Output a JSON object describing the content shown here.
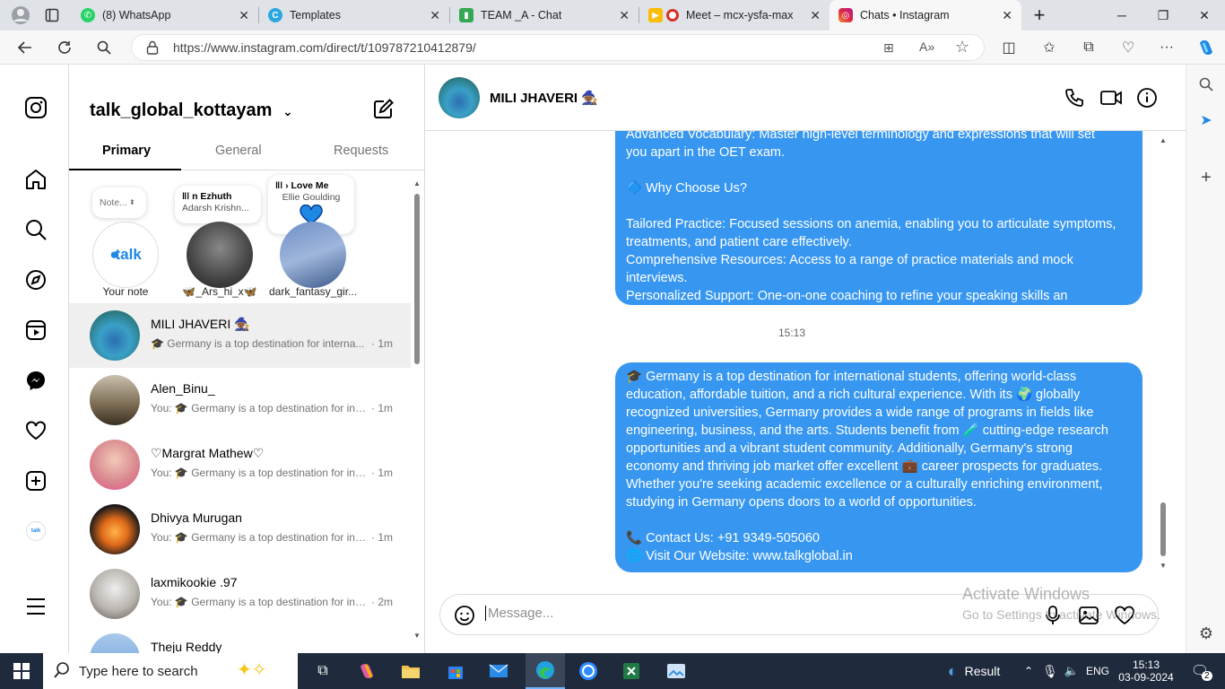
{
  "browser": {
    "tabs": [
      {
        "title": "(8) WhatsApp",
        "icon": "whatsapp-icon",
        "color": "#25d366"
      },
      {
        "title": "Templates",
        "icon": "canva-icon",
        "color": "#2aa7e0"
      },
      {
        "title": "TEAM _A - Chat",
        "icon": "google-chat-icon",
        "color": "#34a853"
      },
      {
        "title": "Meet – mcx-ysfa-max",
        "icon": "google-meet-icon",
        "color": "#d93025"
      },
      {
        "title": "Chats • Instagram",
        "icon": "instagram-icon",
        "color": "#e1306c"
      }
    ],
    "url": "https://www.instagram.com/direct/t/109787210412879/"
  },
  "inbox": {
    "username": "talk_global_kottayam",
    "tabs": [
      "Primary",
      "General",
      "Requests"
    ],
    "notes": [
      {
        "bubble": "Note...",
        "label": "Your note",
        "avatar_text": "talk"
      },
      {
        "bubble_title": "n Ezhuth",
        "bubble_sub": "Adarsh Krishn...",
        "label": "🦋_Ars_hi_x🦋"
      },
      {
        "bubble_title": "Love Me",
        "bubble_sub": "Ellie Goulding",
        "label": "dark_fantasy_gir..."
      }
    ],
    "conversations": [
      {
        "name": "MILI JHAVERI 🧙🏾",
        "preview": "🎓 Germany is a top destination for interna...",
        "time": "· 1m",
        "avatar_color": "#3aa0c8"
      },
      {
        "name": "Alen_Binu_",
        "preview": "You: 🎓 Germany is a top destination for int...",
        "time": "· 1m",
        "avatar_color": "#7a6a52"
      },
      {
        "name": "♡Margrat Mathew♡",
        "preview": "You: 🎓 Germany is a top destination for int...",
        "time": "· 1m",
        "avatar_color": "#d98a8f"
      },
      {
        "name": "Dhivya Murugan",
        "preview": "You: 🎓 Germany is a top destination for int...",
        "time": "· 1m",
        "avatar_color": "#e06a1a"
      },
      {
        "name": "laxmikookie .97",
        "preview": "You: 🎓 Germany is a top destination for int...",
        "time": "· 2m",
        "avatar_color": "#b8b3ad"
      },
      {
        "name": "Theju Reddy",
        "preview": "",
        "time": "",
        "avatar_color": "#6aa0d8"
      }
    ]
  },
  "chat": {
    "name": "MILI JHAVERI 🧙🏾",
    "message1": "Advanced Vocabulary: Master high-level terminology and expressions that will set\nyou apart in the OET exam.\n\n🔷 Why Choose Us?\n\nTailored Practice: Focused sessions on anemia, enabling you to articulate symptoms,\ntreatments, and patient care effectively.\nComprehensive Resources: Access to a range of practice materials and mock\ninterviews.\nPersonalized Support: One-on-one coaching to refine your speaking skills an",
    "timestamp": "15:13",
    "message2": "🎓 Germany is a top destination for international students, offering world-class\neducation, affordable tuition, and a rich cultural experience. With its 🌍 globally\nrecognized universities, Germany provides a wide range of programs in fields like\nengineering, business, and the arts. Students benefit from 🧪 cutting-edge research\nopportunities and a vibrant student community. Additionally, Germany's strong\neconomy and thriving job market offer excellent 💼 career prospects for graduates.\nWhether you're seeking academic excellence or a culturally enriching environment,\nstudying in Germany opens doors to a world of opportunities.\n\n📞 Contact Us: +91 9349-505060\n🌐 Visit Our Website: www.talkglobal.in",
    "composer_placeholder": "Message...",
    "message_bubble_color": "#3797f0"
  },
  "watermark": {
    "line1": "Activate Windows",
    "line2": "Go to Settings to activate Windows."
  },
  "taskbar": {
    "search_placeholder": "Type here to search",
    "weather": "Result",
    "lang": "ENG",
    "time": "15:13",
    "date": "03-09-2024",
    "notif_count": "2"
  }
}
